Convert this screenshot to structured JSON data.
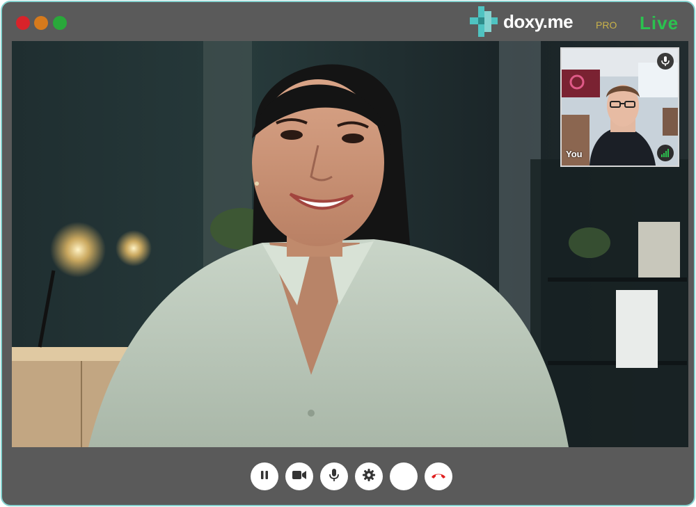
{
  "window": {
    "controls": [
      "close",
      "minimize",
      "maximize"
    ]
  },
  "brand": {
    "name": "doxy.me",
    "tier": "PRO",
    "status": "Live",
    "colors": {
      "accent": "#4fc3c1",
      "live": "#2bc24f",
      "pro": "#c9b24a",
      "frame": "#86d3d0"
    }
  },
  "self_view": {
    "label": "You",
    "icons": [
      "microphone-icon",
      "signal-strength-icon"
    ]
  },
  "controls": [
    {
      "name": "pause-button",
      "icon": "pause-icon"
    },
    {
      "name": "camera-button",
      "icon": "video-camera-icon"
    },
    {
      "name": "microphone-button",
      "icon": "microphone-icon"
    },
    {
      "name": "settings-button",
      "icon": "gear-icon"
    },
    {
      "name": "blank-button",
      "icon": ""
    },
    {
      "name": "end-call-button",
      "icon": "hang-up-icon",
      "color": "#e02020"
    }
  ]
}
